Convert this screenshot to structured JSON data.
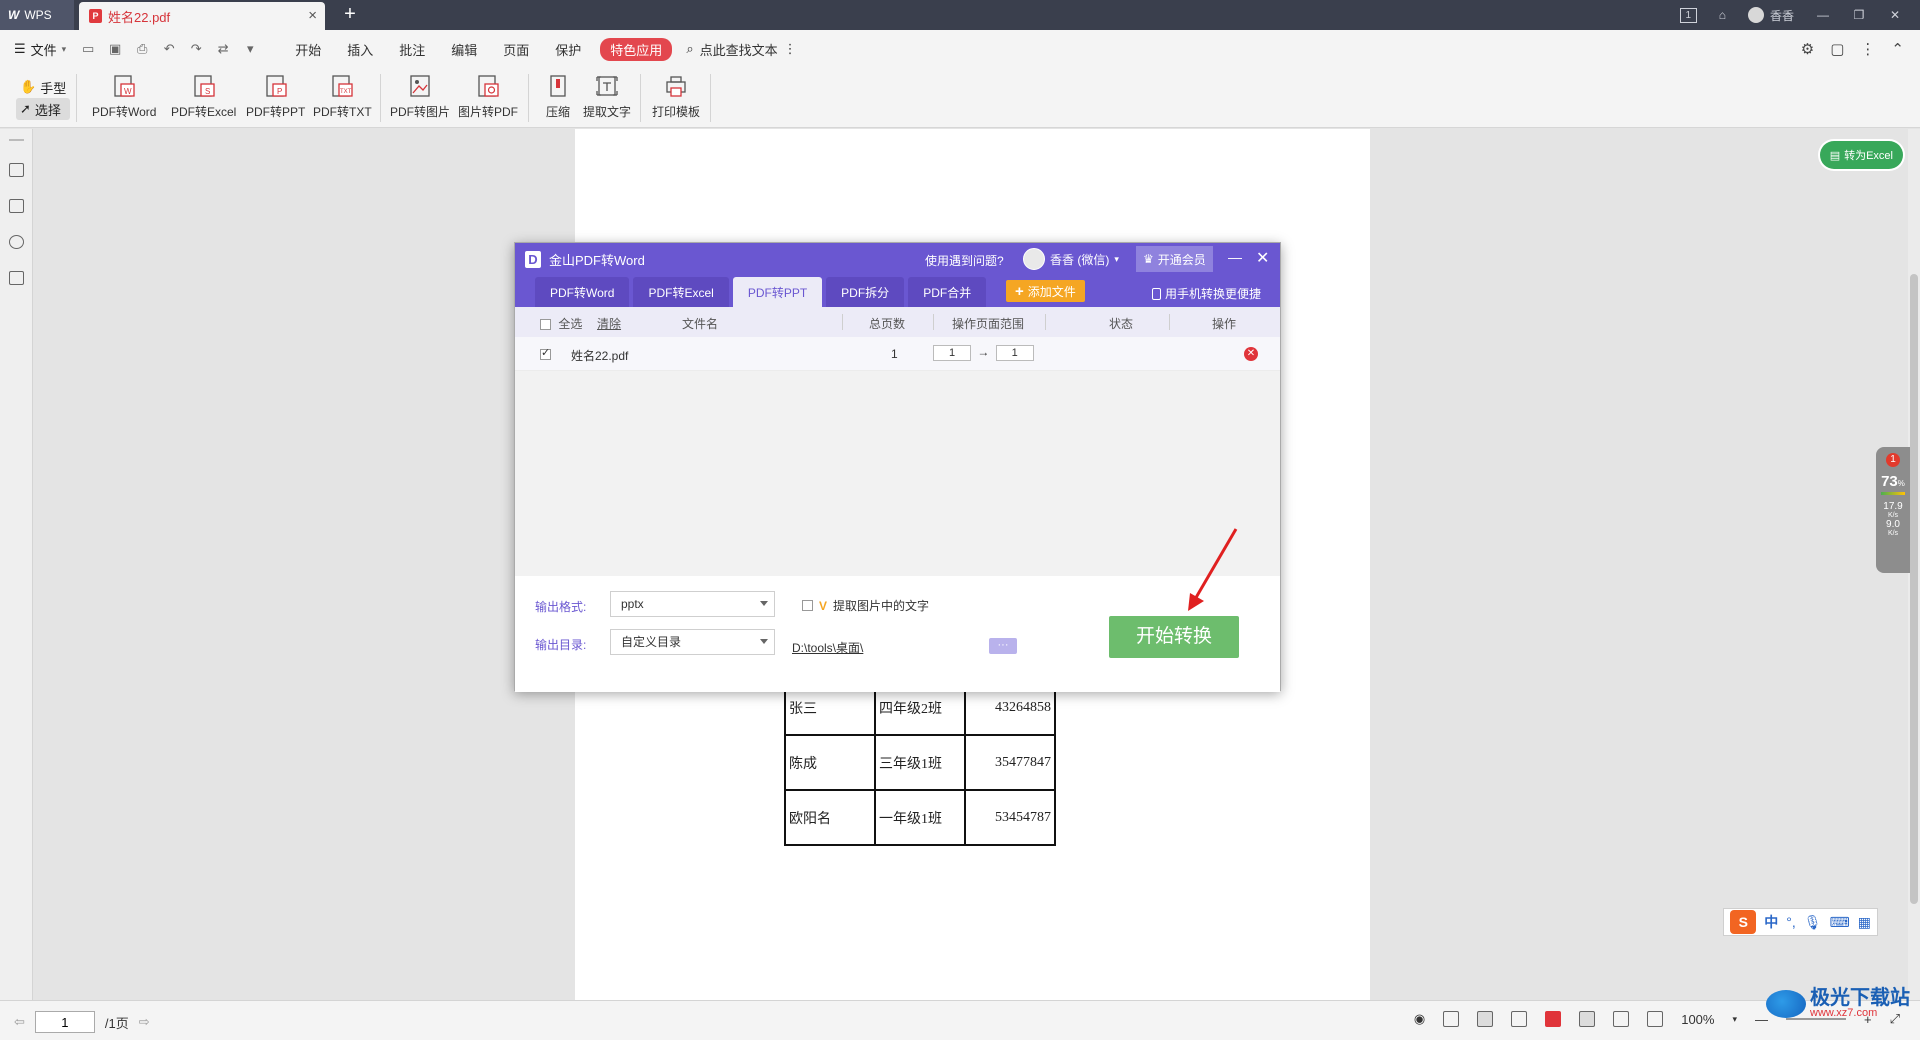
{
  "titlebar": {
    "wps_label": "WPS",
    "doc_tab": "姓名22.pdf",
    "new_tab_symbol": "+",
    "badge": "1",
    "user": "香香"
  },
  "menubar": {
    "file": "文件",
    "tabs": [
      "开始",
      "插入",
      "批注",
      "编辑",
      "页面",
      "保护"
    ],
    "special": "特色应用",
    "search": "点此查找文本"
  },
  "ribbon": {
    "hand": "手型",
    "select": "选择",
    "buttons": [
      "PDF转Word",
      "PDF转Excel",
      "PDF转PPT",
      "PDF转TXT",
      "PDF转图片",
      "图片转PDF",
      "压缩",
      "提取文字",
      "打印模板"
    ]
  },
  "document": {
    "convert_excel": "转为Excel",
    "table": [
      [
        "张三",
        "四年级2班",
        "43264858"
      ],
      [
        "陈成",
        "三年级1班",
        "35477847"
      ],
      [
        "欧阳名",
        "一年级1班",
        "53454787"
      ]
    ]
  },
  "monitor": {
    "badge": "1",
    "percent": "73",
    "percent_unit": "%",
    "up": "17.9",
    "up_unit": "K/s",
    "down": "9.0",
    "down_unit": "K/s"
  },
  "ime": {
    "logo": "S",
    "lang": "中",
    "punct": "°,"
  },
  "dialog": {
    "title": "金山PDF转Word",
    "help": "使用遇到问题?",
    "user": "香香 (微信)",
    "vip": "开通会员",
    "tabs": [
      "PDF转Word",
      "PDF转Excel",
      "PDF转PPT",
      "PDF拆分",
      "PDF合并"
    ],
    "active_tab": "PDF转PPT",
    "add_file": "添加文件",
    "mobile": "用手机转换更便捷",
    "columns": {
      "select_all": "全选",
      "clear": "清除",
      "filename": "文件名",
      "pages": "总页数",
      "range": "操作页面范围",
      "status": "状态",
      "action": "操作"
    },
    "row": {
      "filename": "姓名22.pdf",
      "pages": "1",
      "from": "1",
      "arrow": "→",
      "to": "1"
    },
    "output_format_label": "输出格式:",
    "output_format": "pptx",
    "extract_text": "提取图片中的文字",
    "output_dir_label": "输出目录:",
    "output_dir": "自定义目录",
    "output_path": "D:\\tools\\桌面\\",
    "browse": "···",
    "start": "开始转换"
  },
  "statusbar": {
    "page": "1",
    "total": "/1页",
    "zoom": "100%"
  },
  "watermark": {
    "title": "极光下载站",
    "url": "www.xz7.com"
  },
  "colors": {
    "dialog_purple": "#6a57d1",
    "start_green": "#6dbd6d",
    "special_red": "#e3474e",
    "excel_green": "#38a85a",
    "add_file_orange": "#f5a623"
  }
}
